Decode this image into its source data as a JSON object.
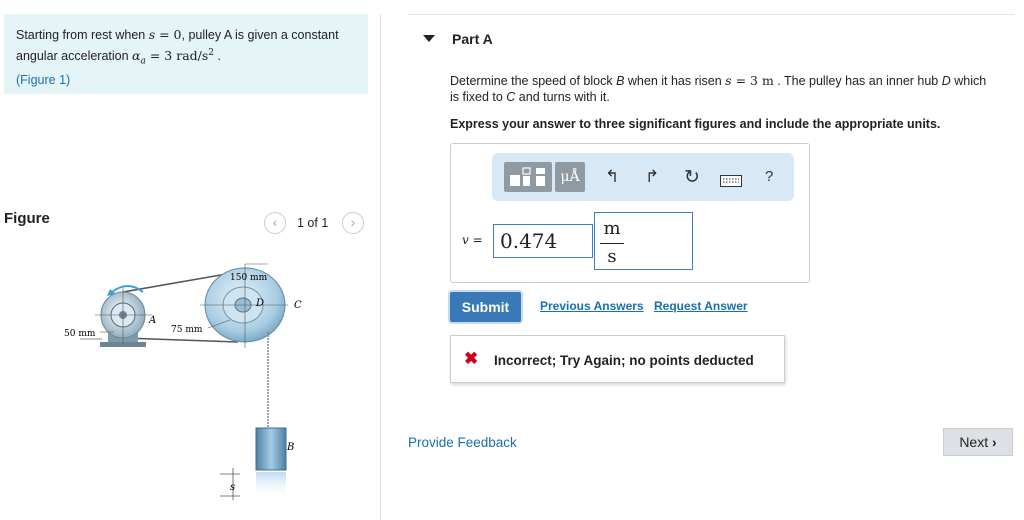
{
  "problem": {
    "text_prefix": "Starting from rest when ",
    "s_var": "s",
    "eq_zero": " = 0",
    "text_mid": ", pulley A is given a constant angular acceleration ",
    "alpha_var": "α",
    "alpha_sub": "a",
    "alpha_val": " = 3 rad/s",
    "alpha_exp": "2",
    "period": " .",
    "figure_link": "(Figure 1)"
  },
  "figure": {
    "header": "Figure",
    "counter": "1 of 1",
    "prev_icon": "chevron-left-icon",
    "next_icon": "chevron-right-icon",
    "labels": {
      "d150": "150 mm",
      "d50": "50 mm",
      "d75": "75 mm",
      "A": "A",
      "B": "B",
      "C": "C",
      "D": "D",
      "s": "s"
    }
  },
  "part": {
    "title": "Part A",
    "question_prefix": "Determine the speed of block ",
    "block_B": "B",
    "question_mid": " when it has risen ",
    "s_var": "s",
    "s_val": " = 3 m",
    "question_rest": " . The pulley has an inner hub ",
    "hub_D": "D",
    "question_rest2": " which is fixed to ",
    "C": "C",
    "question_end": " and turns with it.",
    "instruction": "Express your answer to three significant figures and include the appropriate units."
  },
  "toolbar": {
    "template_icon": "template-icon",
    "units_label": "μÅ",
    "undo_icon": "undo-icon",
    "redo_icon": "redo-icon",
    "reset_icon": "reset-icon",
    "keyboard_icon": "keyboard-icon",
    "help_label": "?"
  },
  "answer": {
    "var_label": "v =",
    "value": "0.474",
    "unit_num": "m",
    "unit_den": "s"
  },
  "actions": {
    "submit": "Submit",
    "previous_answers": "Previous Answers",
    "request_answer": "Request Answer"
  },
  "feedback": {
    "icon": "x-icon",
    "message": "Incorrect; Try Again; no points deducted"
  },
  "footer": {
    "provide_feedback": "Provide Feedback",
    "next": "Next"
  },
  "colors": {
    "link": "#1a6fb0",
    "submit_bg": "#3a79b8",
    "problem_bg": "#e5f4f6",
    "toolbar_bg": "#d7e9f7",
    "error": "#d0021b"
  }
}
